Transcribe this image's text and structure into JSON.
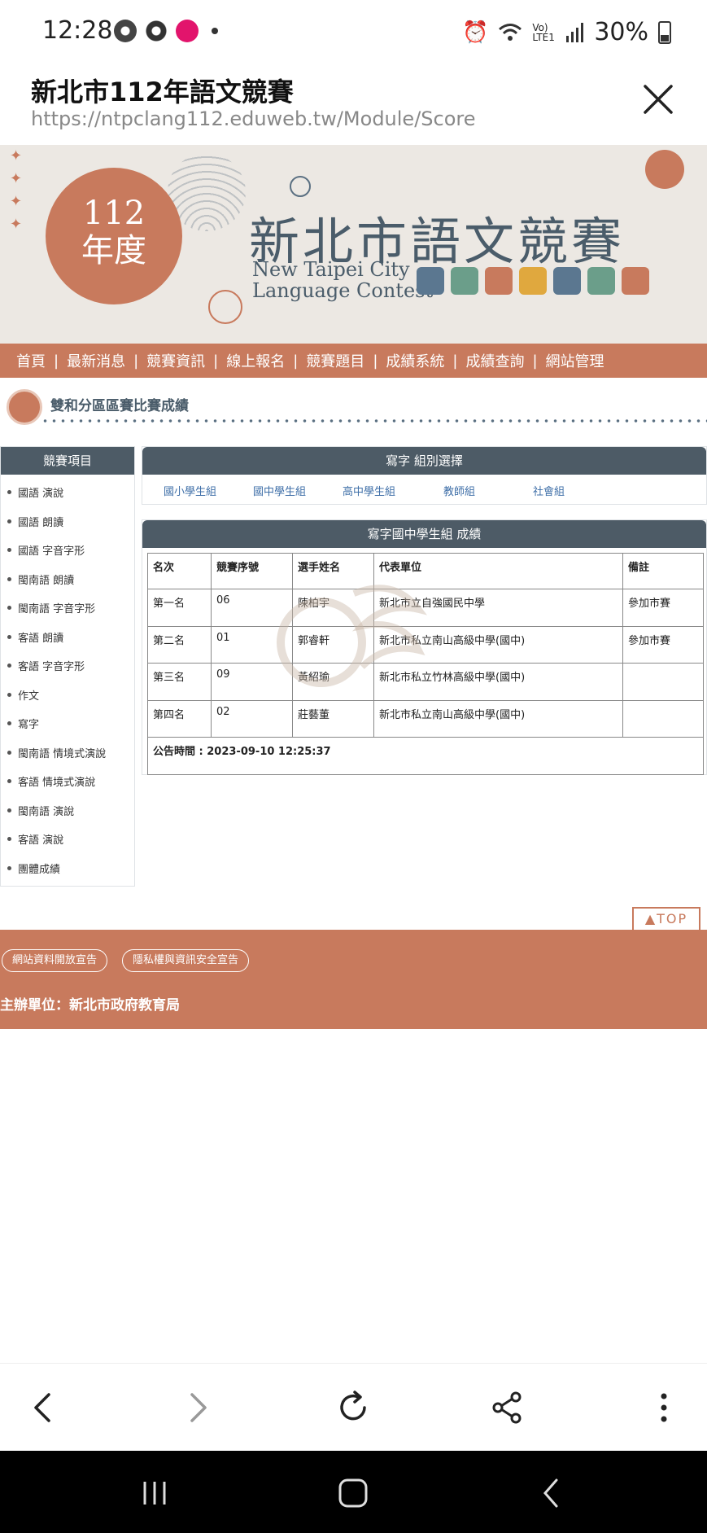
{
  "status_bar": {
    "time": "12:28",
    "battery": "30%",
    "network": "Vo) LTE1"
  },
  "browser": {
    "page_title": "新北市112年語文競賽",
    "url": "https://ntpclang112.eduweb.tw/Module/Score"
  },
  "banner": {
    "year_number": "112",
    "year_suffix": "年度",
    "title": "新北市語文競賽",
    "en_line1": "New Taipei City",
    "en_line2": "Language Contest",
    "icon_colors": [
      "#5b7790",
      "#6b9e8a",
      "#c87a5d",
      "#e0a83e",
      "#5b7790",
      "#6b9e8a",
      "#c87a5d"
    ]
  },
  "nav": {
    "items": [
      "首頁",
      "最新消息",
      "競賽資訊",
      "線上報名",
      "競賽題目",
      "成績系統",
      "成績查詢",
      "網站管理"
    ]
  },
  "section": {
    "title": "雙和分區區賽比賽成績"
  },
  "sidebar": {
    "header": "競賽項目",
    "items": [
      "國語 演說",
      "國語 朗讀",
      "國語 字音字形",
      "閩南語 朗讀",
      "閩南語 字音字形",
      "客語 朗讀",
      "客語 字音字形",
      "作文",
      "寫字",
      "閩南語 情境式演說",
      "客語 情境式演說",
      "閩南語 演說",
      "客語 演說",
      "團體成績"
    ]
  },
  "group_select": {
    "header": "寫字 組別選擇",
    "links": [
      "國小學生組",
      "國中學生組",
      "高中學生組",
      "教師組",
      "社會組"
    ]
  },
  "results": {
    "header": "寫字國中學生組 成績",
    "columns": [
      "名次",
      "競賽序號",
      "選手姓名",
      "代表單位",
      "備註"
    ],
    "rows": [
      [
        "第一名",
        "06",
        "陳柏宇",
        "新北市立自強國民中學",
        "參加市賽"
      ],
      [
        "第二名",
        "01",
        "郭睿軒",
        "新北市私立南山高級中學(國中)",
        "參加市賽"
      ],
      [
        "第三名",
        "09",
        "黃紹瑜",
        "新北市私立竹林高級中學(國中)",
        ""
      ],
      [
        "第四名",
        "02",
        "莊藝董",
        "新北市私立南山高級中學(國中)",
        ""
      ]
    ],
    "announce": "公告時間 : 2023-09-10 12:25:37"
  },
  "top_button": "▲TOP",
  "footer": {
    "open_data": "網站資料開放宣告",
    "privacy": "隱私權與資訊安全宣告",
    "organizer": "主辦單位：新北市政府教育局"
  },
  "colors": {
    "accent": "#c87a5d",
    "header_dark": "#4d5b66",
    "link_blue": "#3f6fa8",
    "banner_bg": "#ece8e3"
  }
}
